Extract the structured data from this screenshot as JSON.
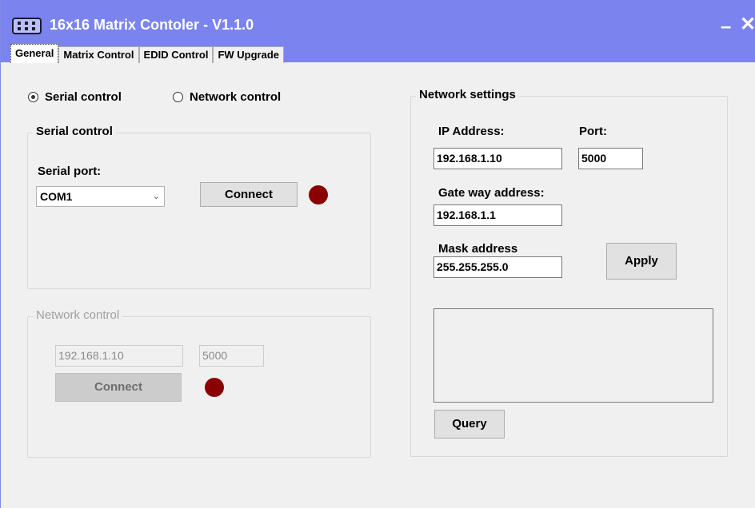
{
  "window": {
    "title": "16x16 Matrix Contoler - V1.1.0",
    "minimize_glyph": "–",
    "close_glyph": "✕",
    "app_icon": "matrix-device-icon"
  },
  "tabs": [
    {
      "label": "General",
      "active": true
    },
    {
      "label": "Matrix Control",
      "active": false
    },
    {
      "label": "EDID Control",
      "active": false
    },
    {
      "label": "FW Upgrade",
      "active": false
    }
  ],
  "mode": {
    "serial_label": "Serial control",
    "network_label": "Network control",
    "selected": "serial"
  },
  "serial_group": {
    "title": "Serial control",
    "port_label": "Serial port:",
    "port_value": "COM1",
    "connect_label": "Connect",
    "status_color": "#8b0000"
  },
  "network_group": {
    "title": "Network control",
    "ip_value": "192.168.1.10",
    "port_value": "5000",
    "connect_label": "Connect",
    "status_color": "#8b0000"
  },
  "network_settings": {
    "title": "Network settings",
    "ip_label": "IP Address:",
    "ip_value": "192.168.1.10",
    "port_label": "Port:",
    "port_value": "5000",
    "gateway_label": "Gate way address:",
    "gateway_value": "192.168.1.1",
    "mask_label": "Mask address",
    "mask_value": "255.255.255.0",
    "apply_label": "Apply",
    "query_label": "Query"
  },
  "colors": {
    "titlebar": "#7b84ee",
    "window_bg": "#f0f0f0",
    "led_off": "#8b0000"
  }
}
